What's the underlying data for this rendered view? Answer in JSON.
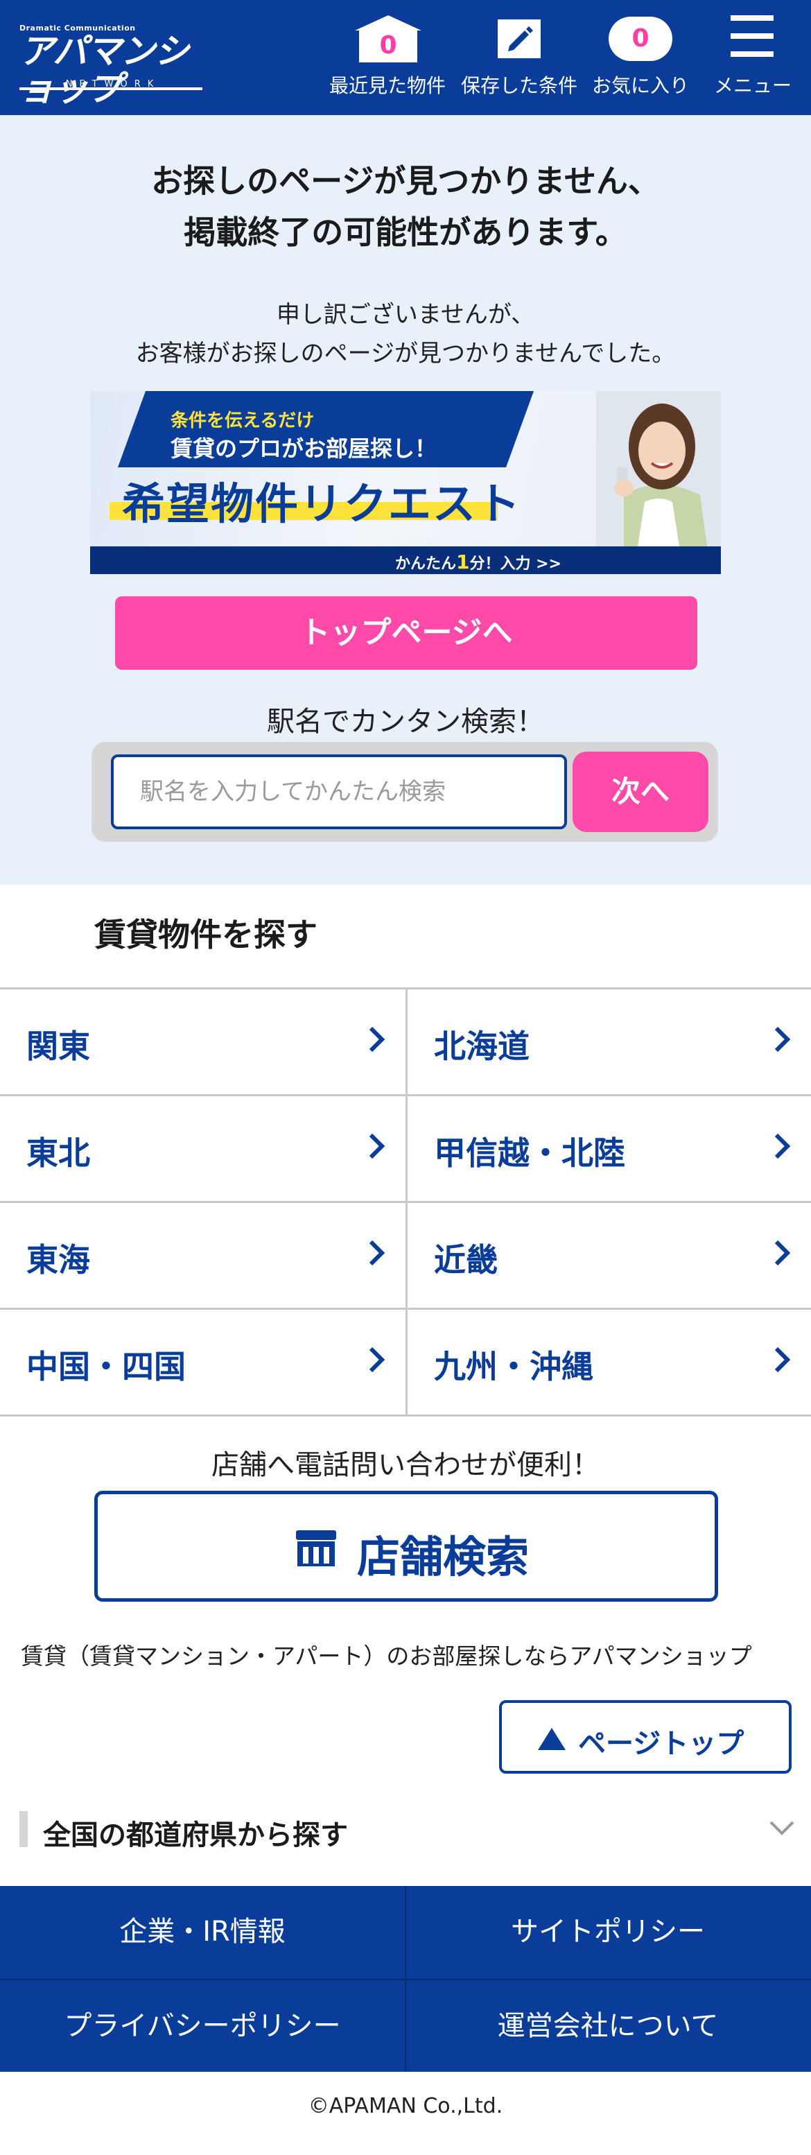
{
  "header": {
    "logo_tagline": "Dramatic Communication",
    "logo_name": "アパマンショップ",
    "logo_network": "NETWORK",
    "recent": {
      "count": "0",
      "label": "最近見た物件"
    },
    "saved": {
      "label": "保存した条件"
    },
    "favorites": {
      "count": "0",
      "label": "お気に入り"
    },
    "menu": {
      "label": "メニュー"
    }
  },
  "notice": {
    "title_line1": "お探しのページが見つかりません、",
    "title_line2": "掲載終了の可能性があります。",
    "sub_line1": "申し訳ございませんが、",
    "sub_line2": "お客様がお探しのページが見つかりませんでした。"
  },
  "banner": {
    "small": "条件を伝えるだけ",
    "mid": "賃貸のプロがお部屋探し！",
    "big": "希望物件リクエスト",
    "foot_prefix": "かんたん",
    "foot_num": "1",
    "foot_suffix": "分！入力 >>"
  },
  "top_page_button": "トップページへ",
  "station_search": {
    "label": "駅名でカンタン検索！",
    "placeholder": "駅名を入力してかんたん検索",
    "next_button": "次へ"
  },
  "rental_section": {
    "title": "賃貸物件を探す",
    "regions": [
      "関東",
      "北海道",
      "東北",
      "甲信越・北陸",
      "東海",
      "近畿",
      "中国・四国",
      "九州・沖縄"
    ]
  },
  "shop": {
    "label": "店舗へ電話問い合わせが便利！",
    "button": "店舗検索"
  },
  "description": "賃貸（賃貸マンション・アパート）のお部屋探しならアパマンショップ",
  "page_top": "ページトップ",
  "prefecture_toggle": "全国の都道府県から探す",
  "footer": {
    "links": [
      "企業・IR情報",
      "サイトポリシー",
      "プライバシーポリシー",
      "運営会社について"
    ],
    "copyright": "©APAMAN Co.,Ltd."
  },
  "colors": {
    "brand_blue": "#0a3d99",
    "accent_pink": "#ff4aa9",
    "hero_bg": "#e8f0fa"
  }
}
